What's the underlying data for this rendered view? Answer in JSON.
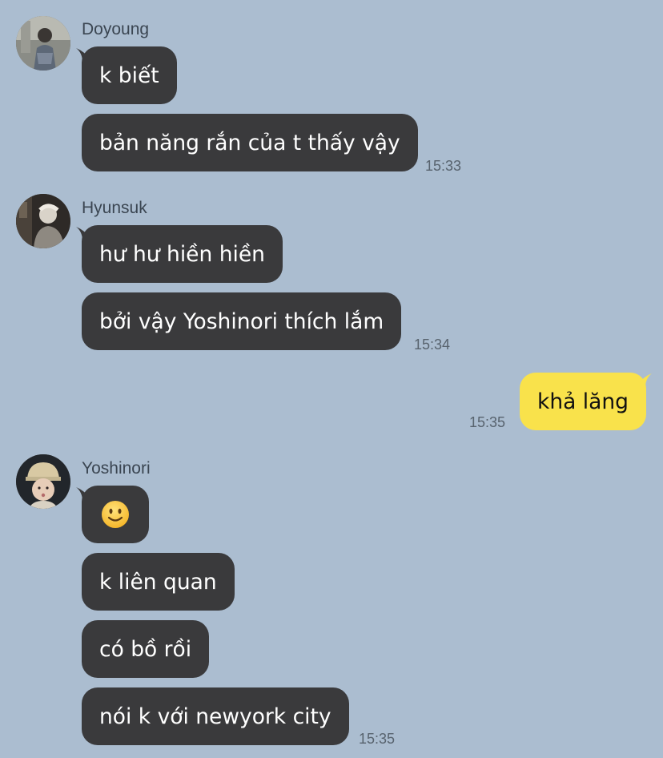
{
  "colors": {
    "background": "#abbdd0",
    "incoming_bubble": "#3a3a3c",
    "outgoing_bubble": "#f9e24b"
  },
  "groups": [
    {
      "sender": "Doyoung",
      "avatar_icon": "profile-photo",
      "messages": [
        "k biết",
        "bản năng rắn của t thấy vậy"
      ],
      "time": "15:33"
    },
    {
      "sender": "Hyunsuk",
      "avatar_icon": "profile-photo",
      "messages": [
        "hư hư hiền hiền",
        "bởi vậy Yoshinori thích lắm"
      ],
      "time": "15:34"
    },
    {
      "sender": "me",
      "messages": [
        "khả lăng"
      ],
      "time": "15:35"
    },
    {
      "sender": "Yoshinori",
      "avatar_icon": "profile-photo",
      "messages": [
        "🙂",
        "k liên quan",
        "có bồ rồi",
        "nói k với newyork city"
      ],
      "time": "15:35"
    }
  ]
}
